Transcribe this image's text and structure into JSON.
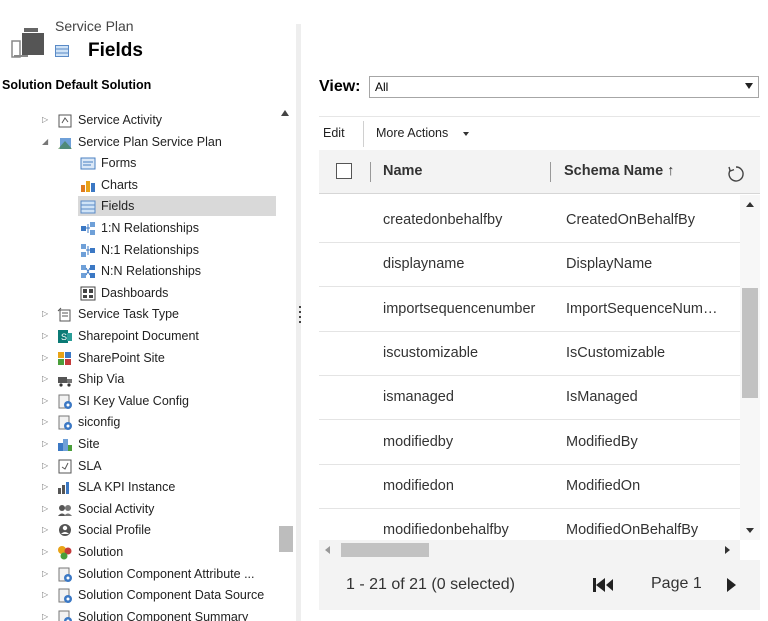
{
  "header": {
    "entity": "Service Plan",
    "title": "Fields"
  },
  "solution_bar": "Solution Default Solution",
  "tree": [
    {
      "label": "Service Activity",
      "icon": "service-activity-icon",
      "indent": 1,
      "arrow": "collapsed"
    },
    {
      "label": "Service Plan Service Plan",
      "icon": "entity-icon",
      "indent": 1,
      "arrow": "expanded"
    },
    {
      "label": "Forms",
      "icon": "forms-icon",
      "indent": 2,
      "arrow": "none"
    },
    {
      "label": "Charts",
      "icon": "charts-icon",
      "indent": 2,
      "arrow": "none"
    },
    {
      "label": "Fields",
      "icon": "fields-icon",
      "indent": 2,
      "arrow": "none",
      "selected": true
    },
    {
      "label": "1:N Relationships",
      "icon": "relationship-1n-icon",
      "indent": 2,
      "arrow": "none"
    },
    {
      "label": "N:1 Relationships",
      "icon": "relationship-n1-icon",
      "indent": 2,
      "arrow": "none"
    },
    {
      "label": "N:N Relationships",
      "icon": "relationship-nn-icon",
      "indent": 2,
      "arrow": "none"
    },
    {
      "label": "Dashboards",
      "icon": "dashboards-icon",
      "indent": 2,
      "arrow": "none"
    },
    {
      "label": "Service Task Type",
      "icon": "service-task-icon",
      "indent": 0,
      "arrow": "collapsed"
    },
    {
      "label": "Sharepoint Document",
      "icon": "sharepoint-document-icon",
      "indent": 0,
      "arrow": "collapsed"
    },
    {
      "label": "SharePoint Site",
      "icon": "sharepoint-site-icon",
      "indent": 0,
      "arrow": "collapsed"
    },
    {
      "label": "Ship Via",
      "icon": "ship-via-icon",
      "indent": 0,
      "arrow": "collapsed"
    },
    {
      "label": "SI Key Value Config",
      "icon": "config-icon",
      "indent": 0,
      "arrow": "collapsed"
    },
    {
      "label": "siconfig",
      "icon": "config-icon",
      "indent": 0,
      "arrow": "collapsed"
    },
    {
      "label": "Site",
      "icon": "site-icon",
      "indent": 0,
      "arrow": "collapsed"
    },
    {
      "label": "SLA",
      "icon": "sla-icon",
      "indent": 0,
      "arrow": "collapsed"
    },
    {
      "label": "SLA KPI Instance",
      "icon": "sla-kpi-icon",
      "indent": 0,
      "arrow": "collapsed"
    },
    {
      "label": "Social Activity",
      "icon": "social-activity-icon",
      "indent": 0,
      "arrow": "collapsed"
    },
    {
      "label": "Social Profile",
      "icon": "social-profile-icon",
      "indent": 0,
      "arrow": "collapsed"
    },
    {
      "label": "Solution",
      "icon": "solution-icon",
      "indent": 0,
      "arrow": "collapsed"
    },
    {
      "label": "Solution Component Attribute ...",
      "icon": "config-icon",
      "indent": 0,
      "arrow": "collapsed"
    },
    {
      "label": "Solution Component Data Source",
      "icon": "config-icon",
      "indent": 0,
      "arrow": "collapsed"
    },
    {
      "label": "Solution Component Summary",
      "icon": "config-icon",
      "indent": 0,
      "arrow": "collapsed"
    }
  ],
  "view": {
    "label": "View:",
    "value": "All"
  },
  "commands": {
    "edit": "Edit",
    "more_actions": "More Actions"
  },
  "grid": {
    "col_name": "Name",
    "col_schema": "Schema Name ↑",
    "rows": [
      {
        "name": "createdonbehalfby",
        "schema": "CreatedOnBehalfBy"
      },
      {
        "name": "displayname",
        "schema": "DisplayName"
      },
      {
        "name": "importsequencenumber",
        "schema": "ImportSequenceNum…"
      },
      {
        "name": "iscustomizable",
        "schema": "IsCustomizable"
      },
      {
        "name": "ismanaged",
        "schema": "IsManaged"
      },
      {
        "name": "modifiedby",
        "schema": "ModifiedBy"
      },
      {
        "name": "modifiedon",
        "schema": "ModifiedOn"
      },
      {
        "name": "modifiedonbehalfby",
        "schema": "ModifiedOnBehalfBy"
      }
    ]
  },
  "footer": {
    "count": "1 - 21 of 21 (0 selected)",
    "page": "Page 1"
  },
  "colors": {
    "selection": "#d9d9d9",
    "header_bg": "#f3f3f3",
    "accent_orange": "#e8a317",
    "accent_blue": "#3b78c4"
  }
}
